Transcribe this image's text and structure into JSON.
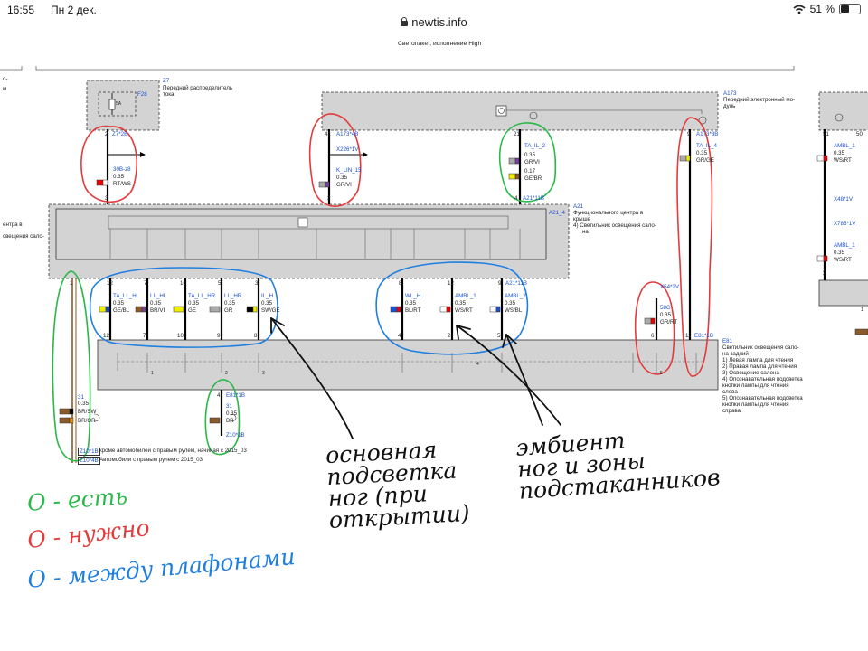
{
  "status_bar": {
    "time": "16:55",
    "date": "Пн 2 дек.",
    "url": "newtis.info",
    "battery_percent": "51 %",
    "battery_level": 0.51
  },
  "diagram": {
    "title": "Светопакет, исполнение High",
    "modules": {
      "z7": {
        "id": "Z7",
        "line1": "Передний распределитель",
        "line2": "тока",
        "fuse": "F28",
        "fuse_rating": "5A"
      },
      "a173": {
        "id": "A173",
        "line1": "Передний электронный мо-",
        "line2": "дуль"
      },
      "a21": {
        "id": "A21",
        "line1": "Функционального центра в",
        "line2": "крыше",
        "line3": "4)  Светильник освещения сало-",
        "line4": "на",
        "connector": "A21_4"
      },
      "e81": {
        "id": "E81",
        "line1": "Светильник освещения сало-",
        "line2": "на задний",
        "items": [
          "1)  Левая лампа для чтения",
          "2)  Правая лампа для чтения",
          "3)  Освещение салона",
          "4)  Опознавательная подсветка",
          "     кнопки лампы для чтения",
          "     слева",
          "5)  Опознавательная подсветка",
          "     кнопки лампы для чтения",
          "     справа"
        ]
      }
    },
    "left_edge_texts": [
      "о-",
      "м",
      "ентра в",
      "свещения сало-"
    ],
    "wires_top": [
      {
        "pin": "2",
        "conn": "Z7*2B",
        "name": "30B-z8",
        "gauge": "0.35",
        "color": "RT/WS",
        "pin_bottom": "3"
      },
      {
        "pin": "41",
        "conn": "A173*4B",
        "sub": "X226*1V",
        "name": "K_LIN_15",
        "gauge": "0.35",
        "color": "GR/VI",
        "pin_bottom": "2"
      },
      {
        "pin": "21",
        "name": "TA_IL_2",
        "gauge": "0.35",
        "color": "GR/VI",
        "gauge2": "0.17",
        "color2": "GE/BR",
        "pin_bottom": "4",
        "conn_bottom": "A21*11B"
      },
      {
        "pin": "9",
        "conn": "A173*3B",
        "name": "TA_IL_4",
        "gauge": "0.35",
        "color": "GR/GE"
      }
    ],
    "wires_bottom": [
      {
        "pin": "12",
        "name": "TA_LL_HL",
        "gauge": "0.35",
        "color": "GE/BL",
        "pin_bottom": "12"
      },
      {
        "pin": "7",
        "name": "LL_HL",
        "gauge": "0.35",
        "color": "BR/VI",
        "pin_bottom": "7"
      },
      {
        "pin": "10",
        "name": "TA_LL_HR",
        "gauge": "0.35",
        "color": "GE",
        "pin_bottom": "10"
      },
      {
        "pin": "5",
        "name": "LL_HR",
        "gauge": "0.35",
        "color": "GR",
        "pin_bottom": "9"
      },
      {
        "pin": "3",
        "name": "IL_H",
        "gauge": "0.35",
        "color": "SW/GE",
        "pin_bottom": "8"
      },
      {
        "pin": "8",
        "name": "WL_H",
        "gauge": "0.35",
        "color": "BL/RT",
        "pin_bottom": "4"
      },
      {
        "pin": "12",
        "name": "AMBL_1",
        "gauge": "0.35",
        "color": "WS/RT",
        "pin_bottom": "2"
      },
      {
        "pin": "9",
        "conn": "A21*11B",
        "name": "AMBL_2",
        "gauge": "0.35",
        "color": "WS/BL",
        "pin_bottom": "5"
      }
    ],
    "x54": {
      "conn": "X54*2V",
      "name": "58G",
      "gauge": "0.35",
      "color": "GR/RT",
      "pin_bottom": "6",
      "pin_bottom2": "11",
      "conn2": "E81*1B"
    },
    "ground_left": {
      "pin": "1",
      "name": "31",
      "gauge": "0.35",
      "color": "BR/SW",
      "color2": "BR/OR"
    },
    "ground_mid": {
      "pin": "4",
      "conn": "E81*1B",
      "name": "31",
      "gauge": "0.35",
      "color": "BR",
      "bottom": "Z10*1B"
    },
    "z10_notes": [
      {
        "tag": "Z10*1B",
        "text": "кроме автомобилей с правым рулем, начиная с 2015_03"
      },
      {
        "tag": "Z10*4B",
        "text": "Автомобили с правым рулем с 2015_03"
      }
    ],
    "e81_pins": [
      "1",
      "2",
      "3",
      "4",
      "5"
    ],
    "right_panel": {
      "pin_top_a": "51",
      "pin_top_b": "50",
      "w1_name": "AMBL_1",
      "w1_gauge": "0.35",
      "w1_color": "WS/RT",
      "x1": "X48*1V",
      "x2": "X785*1V",
      "w2_name": "AMBL_1",
      "w2_gauge": "0.35",
      "w2_color": "WS/RT",
      "pin_a": "2",
      "pin_b": "1"
    }
  },
  "annotations": {
    "base_light": [
      "основная",
      "подсветка",
      "ног (при",
      "открытии)"
    ],
    "ambient": [
      "эмбиент",
      "ног и зоны",
      "подстаканников"
    ],
    "legend": [
      {
        "text": "О - есть",
        "color": "#2bb84a"
      },
      {
        "text": "О - нужно",
        "color": "#e23b3b"
      },
      {
        "text": "О - между плафонами",
        "color": "#1f7fe0"
      }
    ]
  }
}
